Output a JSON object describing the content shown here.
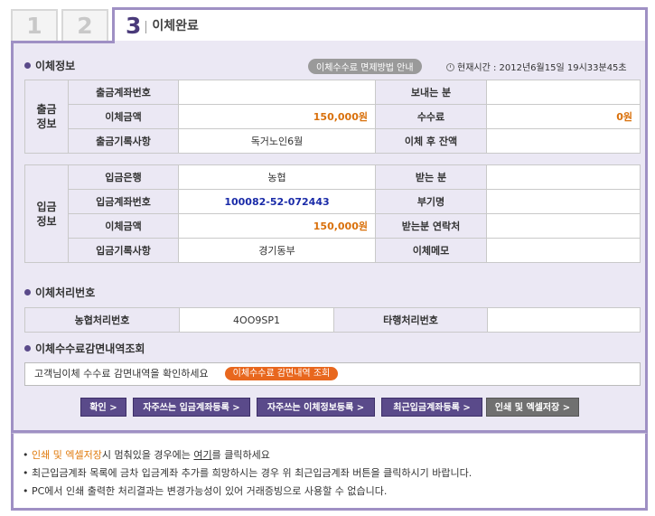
{
  "tabs": [
    {
      "label": "1"
    },
    {
      "label": "2"
    },
    {
      "label": "3",
      "title": "이체완료"
    }
  ],
  "transfer_info": {
    "section_title": "이체정보",
    "fee_guide_label": "이체수수료 면제방법 안내",
    "current_time": "현재시간 : 2012년6월15일 19시33분45초",
    "withdrawal": {
      "group_label": "출금정보",
      "rows": [
        {
          "label": "출금계좌번호",
          "value": "",
          "label2": "보내는 분",
          "value2": ""
        },
        {
          "label": "이체금액",
          "value": "150,000원",
          "label2": "수수료",
          "value2": "0원"
        },
        {
          "label": "출금기록사항",
          "value": "독거노인6월",
          "label2": "이체 후 잔액",
          "value2": ""
        }
      ]
    },
    "deposit": {
      "group_label": "입금정보",
      "rows": [
        {
          "label": "입금은행",
          "value": "농협",
          "label2": "받는 분",
          "value2": ""
        },
        {
          "label": "입금계좌번호",
          "value": "100082-52-072443",
          "label2": "부기명",
          "value2": ""
        },
        {
          "label": "이체금액",
          "value": "150,000원",
          "label2": "받는분 연락처",
          "value2": ""
        },
        {
          "label": "입금기록사항",
          "value": "경기동부",
          "label2": "이체메모",
          "value2": ""
        }
      ]
    }
  },
  "processing": {
    "section_title": "이체처리번호",
    "nh_label": "농협처리번호",
    "nh_value": "4OO9SP1",
    "other_label": "타행처리번호",
    "other_value": ""
  },
  "fee_reduction": {
    "section_title": "이체수수료감면내역조회",
    "message": "고객님이체 수수료 감면내역을 확인하세요",
    "button_label": "이체수수료 감면내역 조회"
  },
  "buttons": {
    "confirm": "확인 >",
    "register_deposit_account": "자주쓰는 입금계좌등록 >",
    "register_transfer_info": "자주쓰는 이체정보등록 >",
    "register_recent_account": "최근입금계좌등록 >",
    "print_excel": "인쇄 및 엑셀저장 >"
  },
  "notes": {
    "n1_prefix": "• ",
    "n1_highlight": "인쇄 및 엑셀저장",
    "n1_mid": "시 멈춰있을 경우에는 ",
    "n1_link": "여기",
    "n1_suffix": "를 클릭하세요",
    "n2": "• 최근입금계좌 목록에 금차 입금계좌 추가를 희망하시는 경우 위 최근입금계좌 버튼을 클릭하시기 바랍니다.",
    "n3": "• PC에서 인쇄 출력한 처리결과는 변경가능성이 있어 거래증빙으로 사용할 수 없습니다."
  },
  "colors": {
    "accent": "#5a4a8a",
    "border": "#9f90c4",
    "amount": "#d9700b",
    "account": "#1a2ba8",
    "orange_pill": "#e8671e"
  }
}
